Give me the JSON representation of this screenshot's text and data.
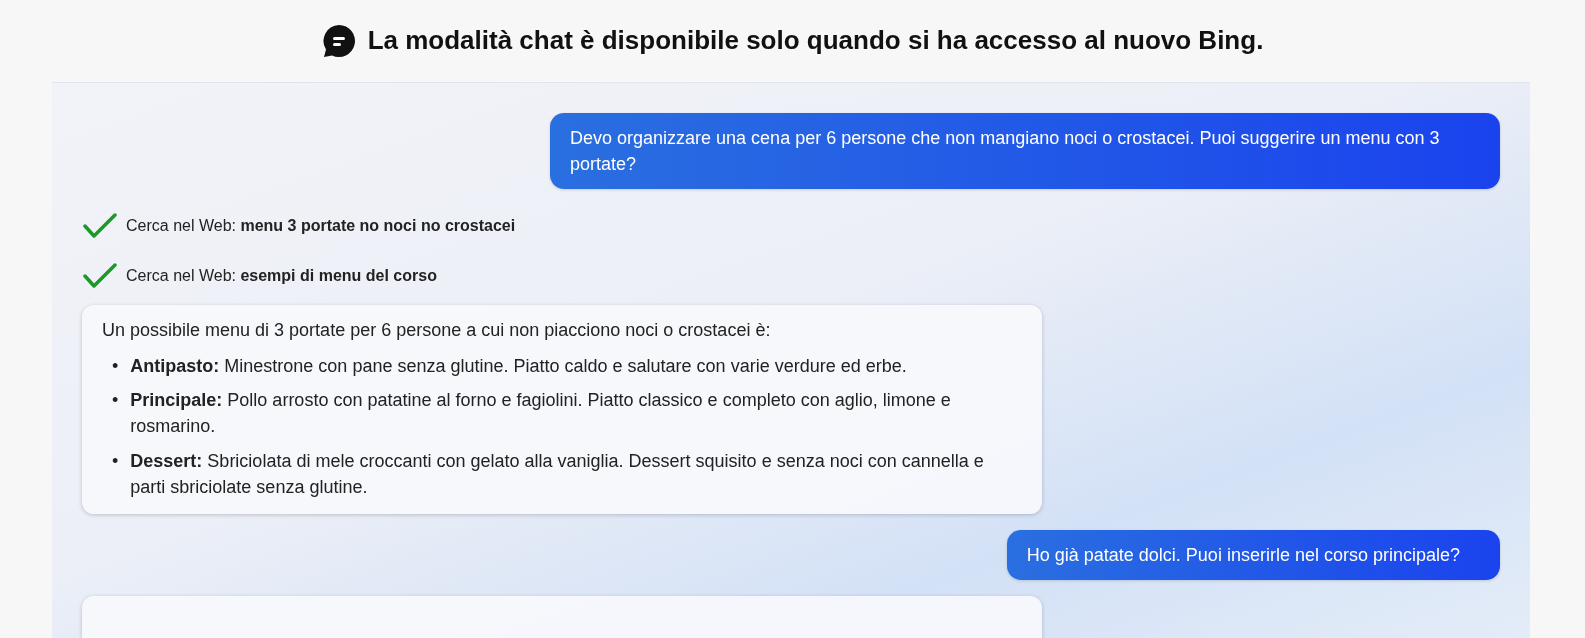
{
  "header": {
    "title": "La modalità chat è disponibile solo quando si ha accesso al nuovo Bing."
  },
  "messages": [
    {
      "kind": "user",
      "text": "Devo organizzare una cena per 6 persone che non mangiano noci o crostacei. Puoi suggerire un menu con 3 portate?"
    },
    {
      "kind": "search",
      "done": true,
      "text": "Cerca nel Web: **menu 3 portate no noci no crostacei**"
    },
    {
      "kind": "search",
      "done": true,
      "text": "Cerca nel Web: **esempi di menu del corso**"
    },
    {
      "kind": "bot",
      "intro": "Un possibile menu di 3 portate per 6 persone a cui non piacciono noci o crostacei è:",
      "items": [
        {
          "bullet": "•",
          "text": "**Antipasto:** Minestrone con pane senza glutine. Piatto caldo e salutare con varie verdure ed erbe."
        },
        {
          "bullet": "•",
          "text": "**Principale:** Pollo arrosto con patatine al forno e fagiolini. Piatto classico e completo con aglio, limone e rosmarino."
        },
        {
          "bullet": "•",
          "text": "**Dessert:** Sbriciolata di mele croccanti con gelato alla vaniglia. Dessert squisito e senza noci con cannella e parti sbriciolate senza glutine."
        }
      ]
    },
    {
      "kind": "user",
      "text": "Ho già patate dolci. Puoi inserirle nel corso principale?"
    },
    {
      "kind": "bot"
    }
  ]
}
